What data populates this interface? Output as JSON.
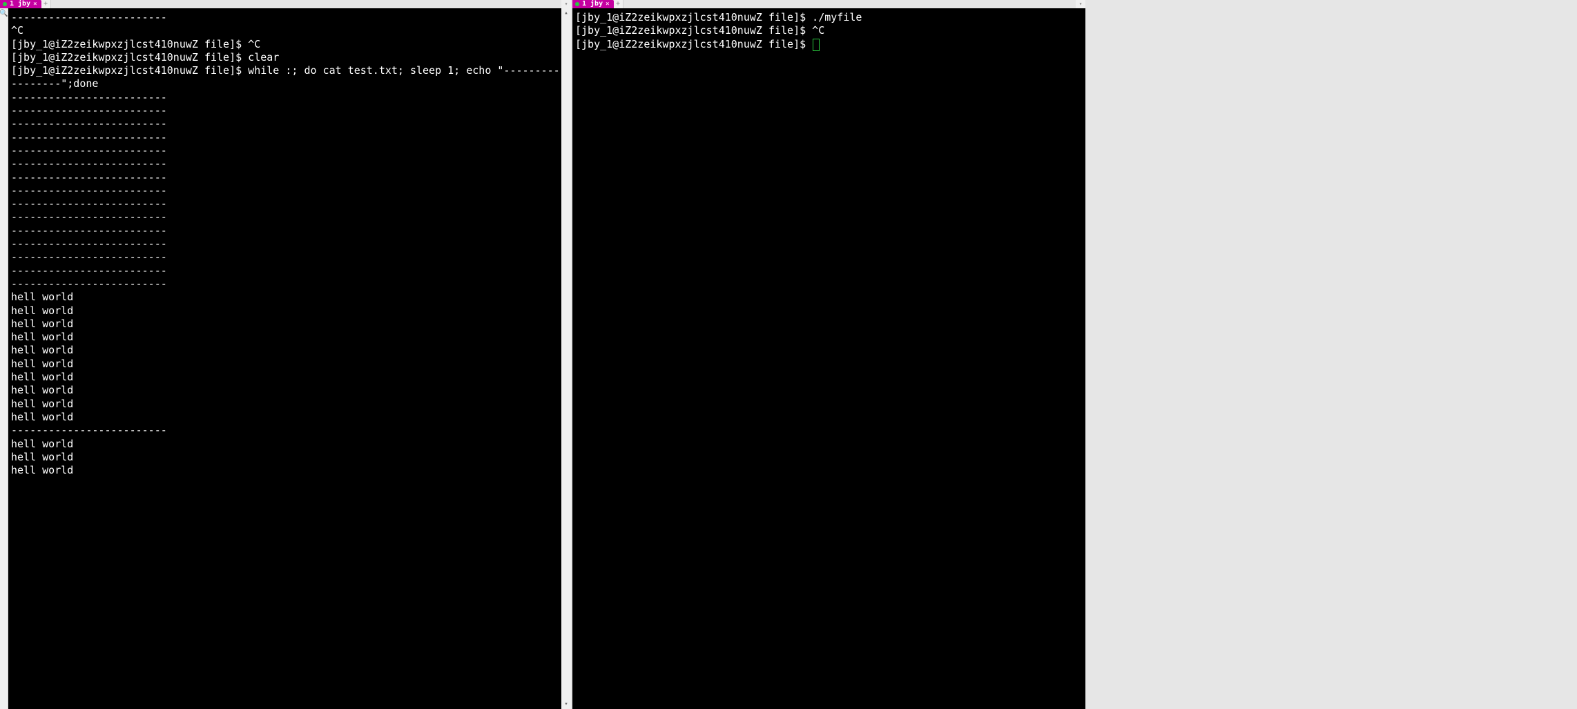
{
  "tabs": {
    "left": {
      "title": "1 jby"
    },
    "right": {
      "title": "1 jby"
    }
  },
  "colors": {
    "tab_bg": "#c400a0",
    "running_dot": "#29c93f",
    "cursor_outline": "#29c93f"
  },
  "prompt": "[jby_1@iZ2zeikwpxzjlcst410nuwZ file]$ ",
  "separator_short": "-------------------------",
  "left_terminal": {
    "lines": [
      "-------------------------",
      "^C",
      "[jby_1@iZ2zeikwpxzjlcst410nuwZ file]$ ^C",
      "[jby_1@iZ2zeikwpxzjlcst410nuwZ file]$ clear",
      "[jby_1@iZ2zeikwpxzjlcst410nuwZ file]$ while :; do cat test.txt; sleep 1; echo \"-----------------",
      "--------\";done",
      "-------------------------",
      "-------------------------",
      "-------------------------",
      "-------------------------",
      "-------------------------",
      "-------------------------",
      "-------------------------",
      "-------------------------",
      "-------------------------",
      "-------------------------",
      "-------------------------",
      "-------------------------",
      "-------------------------",
      "-------------------------",
      "-------------------------",
      "hell world",
      "hell world",
      "hell world",
      "hell world",
      "hell world",
      "hell world",
      "hell world",
      "hell world",
      "hell world",
      "hell world",
      "-------------------------",
      "hell world",
      "hell world",
      "hell world"
    ]
  },
  "right_terminal": {
    "lines": [
      "[jby_1@iZ2zeikwpxzjlcst410nuwZ file]$ ./myfile",
      "[jby_1@iZ2zeikwpxzjlcst410nuwZ file]$ ^C",
      "[jby_1@iZ2zeikwpxzjlcst410nuwZ file]$ "
    ]
  }
}
